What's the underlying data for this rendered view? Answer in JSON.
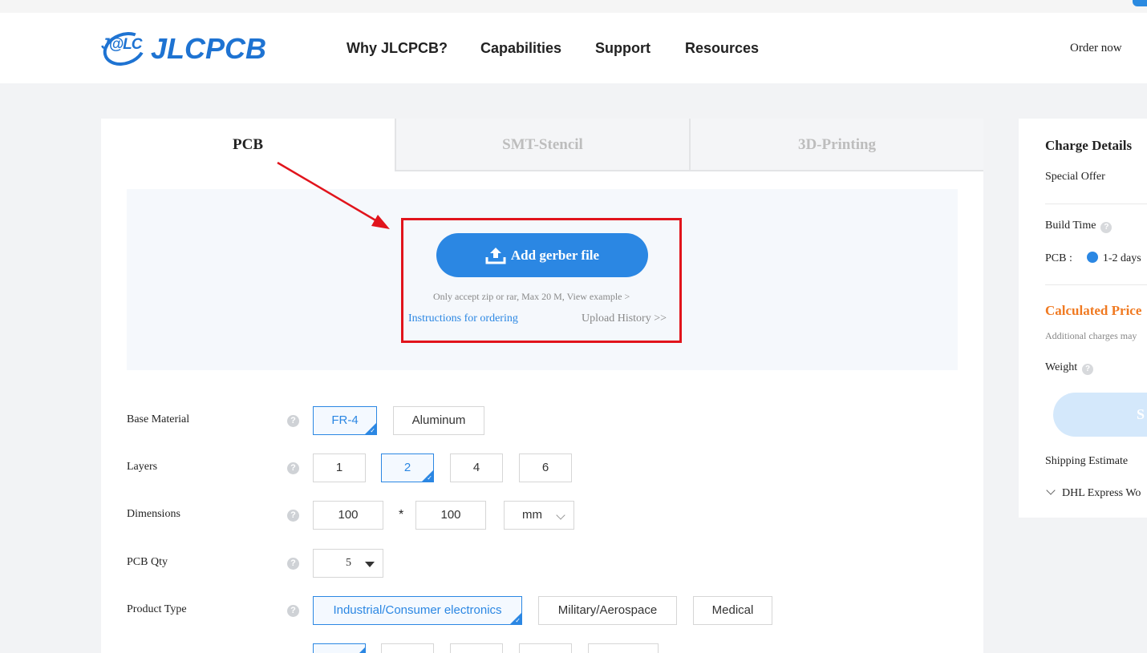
{
  "header": {
    "logo_badge": "J@LC",
    "logo_text": "JLCPCB",
    "nav": [
      "Why JLCPCB?",
      "Capabilities",
      "Support",
      "Resources"
    ],
    "order_now": "Order now"
  },
  "tabs": [
    "PCB",
    "SMT-Stencil",
    "3D-Printing"
  ],
  "upload": {
    "button_label": "Add gerber file",
    "note": "Only accept zip or rar, Max 20 M, View example >",
    "instructions": "Instructions for ordering",
    "history": "Upload History >>"
  },
  "options": {
    "base_material": {
      "label": "Base Material",
      "choices": [
        "FR-4",
        "Aluminum"
      ],
      "selected": "FR-4"
    },
    "layers": {
      "label": "Layers",
      "choices": [
        "1",
        "2",
        "4",
        "6"
      ],
      "selected": "2"
    },
    "dimensions": {
      "label": "Dimensions",
      "width": "100",
      "height": "100",
      "separator": "*",
      "unit": "mm"
    },
    "pcb_qty": {
      "label": "PCB Qty",
      "value": "5"
    },
    "product_type": {
      "label": "Product Type",
      "choices": [
        "Industrial/Consumer electronics",
        "Military/Aerospace",
        "Medical"
      ],
      "selected": "Industrial/Consumer electronics"
    }
  },
  "sidebar": {
    "title": "Charge Details",
    "special_offer": "Special Offer",
    "build_time": "Build Time",
    "pcb_label": "PCB :",
    "pcb_time": "1-2 days",
    "calculated_price": "Calculated Price",
    "additional_note": "Additional charges may",
    "weight": "Weight",
    "button_text": "S",
    "shipping_estimate": "Shipping Estimate",
    "shipping_method": "DHL Express Wo"
  },
  "colors": {
    "brand_blue": "#1e73d2",
    "accent_blue": "#2b87e3",
    "highlight_red": "#e1141c",
    "price_orange": "#f07a22"
  }
}
